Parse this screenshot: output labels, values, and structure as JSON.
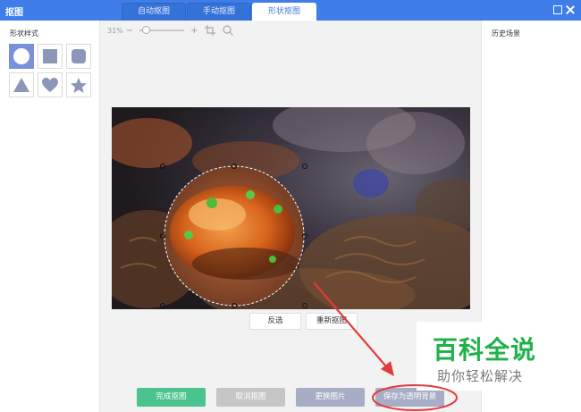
{
  "window": {
    "title": "抠图",
    "tabs": [
      {
        "label": "自动抠图",
        "active": false
      },
      {
        "label": "手动抠图",
        "active": false
      },
      {
        "label": "形状抠图",
        "active": true
      }
    ],
    "accent": "#3f7ee8"
  },
  "left_panel": {
    "title": "形状样式",
    "shapes": [
      {
        "name": "circle-icon",
        "selected": true
      },
      {
        "name": "square-icon",
        "selected": false
      },
      {
        "name": "rounded-square-icon",
        "selected": false
      },
      {
        "name": "triangle-icon",
        "selected": false
      },
      {
        "name": "heart-icon",
        "selected": false
      },
      {
        "name": "star-icon",
        "selected": false
      }
    ],
    "selected_color": "#7a90db",
    "shape_color": "#8b96b8"
  },
  "canvas": {
    "zoom_label": "31%"
  },
  "mid_actions": {
    "invert_label": "反选",
    "rematte_label": "重新抠图"
  },
  "bottom_actions": {
    "complete_label": "完成抠图",
    "cancel_label": "取消抠图",
    "change_label": "更换图片",
    "save_transparent_label": "保存为透明背景",
    "colors": {
      "complete": "#4bc38f",
      "cancel": "#c6c6c6",
      "change": "#a7adc4",
      "save": "#a7adc4"
    }
  },
  "right_panel": {
    "title": "历史场景"
  },
  "watermark": {
    "title": "百科全说",
    "subtitle": "助你轻松解决",
    "color": "#1fb24a"
  },
  "annotation_color": "#e23b3b"
}
